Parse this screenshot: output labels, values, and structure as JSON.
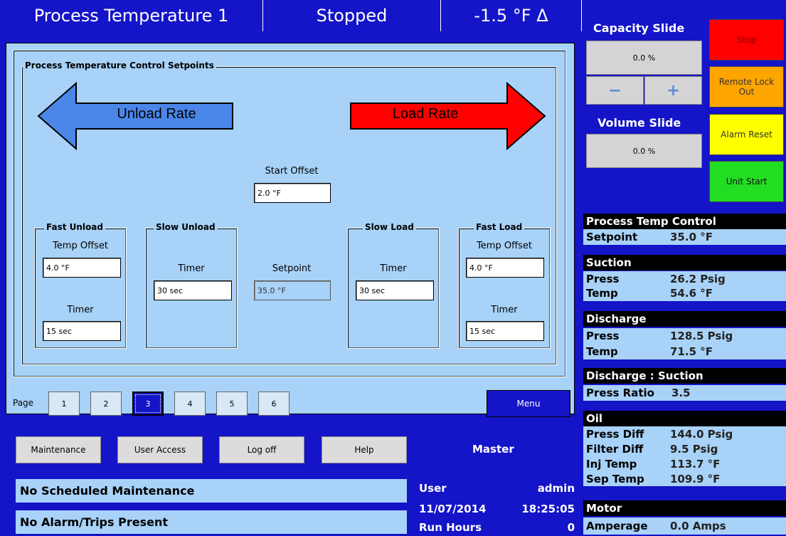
{
  "header": {
    "title": "Process Temperature 1",
    "state": "Stopped",
    "delta": "-1.5 °F Δ"
  },
  "setpoints": {
    "group_title": "Process Temperature Control Setpoints",
    "unload_rate": "Unload Rate",
    "load_rate": "Load Rate",
    "start_offset_label": "Start Offset",
    "start_offset_value": "2.0 °F",
    "fast_unload": {
      "title": "Fast Unload",
      "temp_offset_label": "Temp Offset",
      "temp_offset_value": "4.0 °F",
      "timer_label": "Timer",
      "timer_value": "15 sec"
    },
    "slow_unload": {
      "title": "Slow Unload",
      "timer_label": "Timer",
      "timer_value": "30 sec"
    },
    "setpoint_label": "Setpoint",
    "setpoint_value": "35.0 °F",
    "slow_load": {
      "title": "Slow Load",
      "timer_label": "Timer",
      "timer_value": "30 sec"
    },
    "fast_load": {
      "title": "Fast Load",
      "temp_offset_label": "Temp Offset",
      "temp_offset_value": "4.0 °F",
      "timer_label": "Timer",
      "timer_value": "15 sec"
    }
  },
  "pager": {
    "label": "Page",
    "pages": [
      "1",
      "2",
      "3",
      "4",
      "5",
      "6"
    ],
    "current": "3",
    "menu_label": "Menu"
  },
  "bottom": {
    "buttons": [
      "Maintenance",
      "User Access",
      "Log off",
      "Help"
    ],
    "role": "Master",
    "maintenance_status": "No Scheduled Maintenance",
    "alarm_status": "No Alarm/Trips Present",
    "user_label": "User",
    "user_value": "admin",
    "date": "11/07/2014",
    "time": "18:25:05",
    "run_hours_label": "Run Hours",
    "run_hours_value": "0"
  },
  "sidebar": {
    "capacity_title": "Capacity Slide",
    "capacity_value": "0.0 %",
    "minus_label": "−",
    "plus_label": "+",
    "volume_title": "Volume Slide",
    "volume_value": "0.0 %",
    "stop_label": "Stop",
    "remote_lock_label": "Remote Lock Out",
    "alarm_reset_label": "Alarm Reset",
    "unit_start_label": "Unit Start",
    "colors": {
      "stop": "#ff0000",
      "remote": "#ffa500",
      "alarm": "#ffff00",
      "start": "#22dd22"
    }
  },
  "readings": {
    "ptc_title": "Process Temp Control",
    "setpoint_k": "Setpoint",
    "setpoint_v": "35.0 °F",
    "suction_title": "Suction",
    "suction_press_k": "Press",
    "suction_press_v": "26.2 Psig",
    "suction_temp_k": "Temp",
    "suction_temp_v": "54.6 °F",
    "discharge_title": "Discharge",
    "discharge_press_k": "Press",
    "discharge_press_v": "128.5 Psig",
    "discharge_temp_k": "Temp",
    "discharge_temp_v": "71.5 °F",
    "ratio_title": "Discharge : Suction",
    "ratio_k": "Press Ratio",
    "ratio_v": "3.5",
    "oil_title": "Oil",
    "oil_press_k": "Press Diff",
    "oil_press_v": "144.0 Psig",
    "oil_filter_k": "Filter Diff",
    "oil_filter_v": "9.5 Psig",
    "oil_inj_k": "Inj Temp",
    "oil_inj_v": "113.7 °F",
    "oil_sep_k": "Sep Temp",
    "oil_sep_v": "109.9 °F",
    "motor_title": "Motor",
    "motor_amp_k": "Amperage",
    "motor_amp_v": "0.0 Amps"
  }
}
